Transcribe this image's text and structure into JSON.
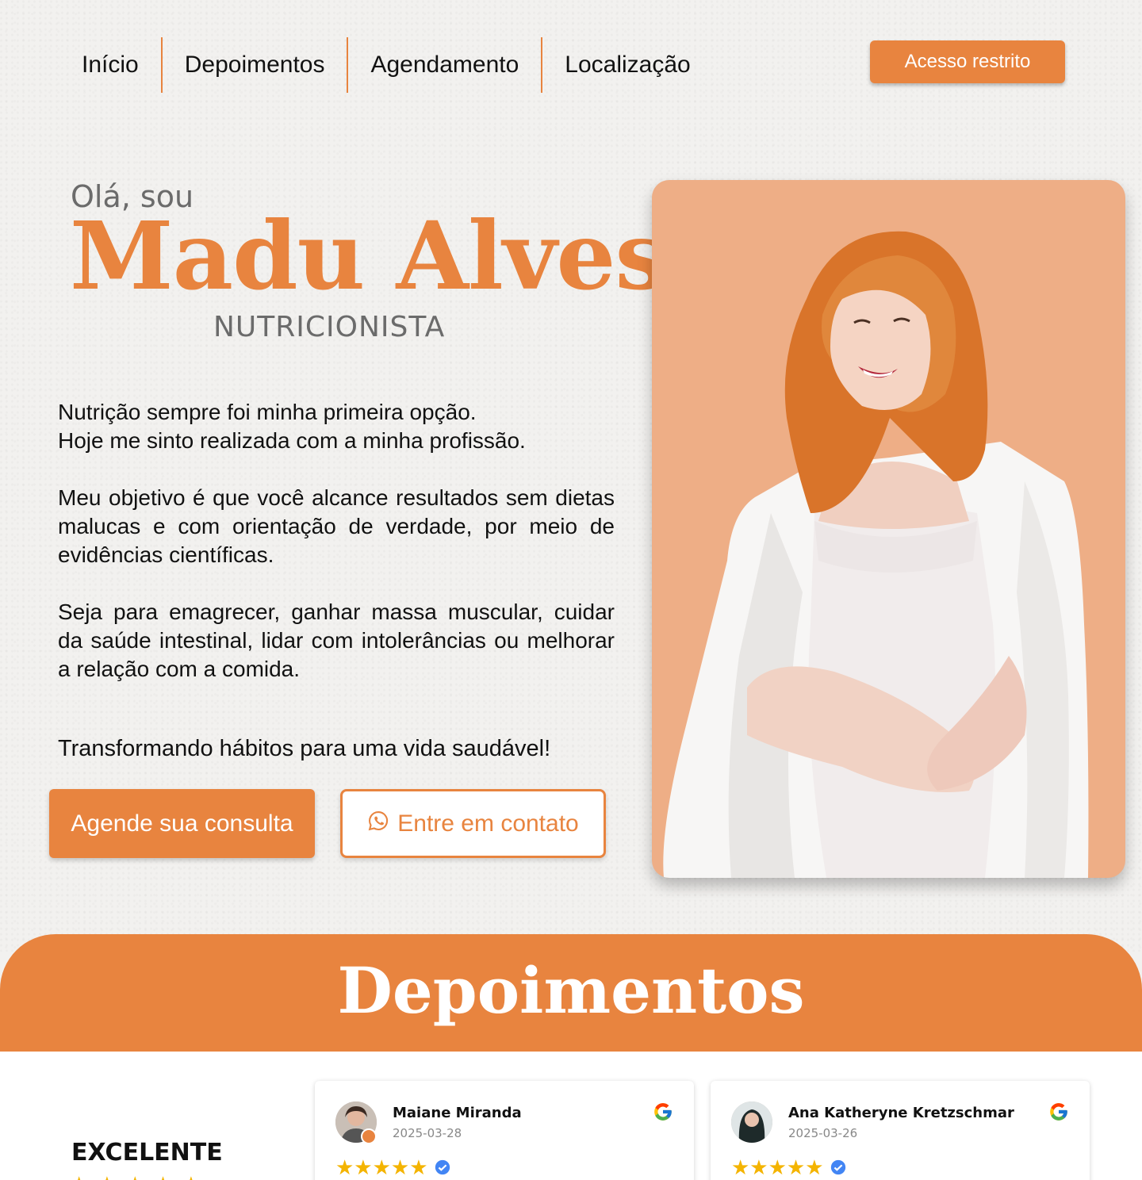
{
  "nav": {
    "items": [
      {
        "label": "Início"
      },
      {
        "label": "Depoimentos"
      },
      {
        "label": "Agendamento"
      },
      {
        "label": "Localização"
      }
    ],
    "restricted_label": "Acesso restrito"
  },
  "hero": {
    "greeting": "Olá, sou",
    "name": "Madu Alves",
    "role": "NUTRICIONISTA",
    "bio": [
      "Nutrição sempre foi minha primeira opção.\nHoje me sinto realizada com a minha profissão.",
      "Meu objetivo é que você alcance resultados sem dietas malucas e com orientação de verdade, por meio de evidências científicas.",
      "Seja para emagrecer, ganhar massa muscular, cuidar da saúde intestinal, lidar com intolerâncias ou melhorar a relação com a comida."
    ],
    "tagline": "Transformando hábitos para uma vida saudável!",
    "cta_primary": "Agende sua consulta",
    "cta_secondary": "Entre em contato"
  },
  "testimonials": {
    "title": "Depoimentos",
    "rating_label": "EXCELENTE",
    "reviews": [
      {
        "author": "Maiane Miranda",
        "date": "2025-03-28",
        "stars": 5
      },
      {
        "author": "Ana Katheryne Kretzschmar",
        "date": "2025-03-26",
        "stars": 5
      }
    ]
  },
  "colors": {
    "accent": "#e8843f",
    "photo_bg": "#eeae86",
    "star": "#f4b400"
  },
  "icons": {
    "whatsapp": "whatsapp-icon",
    "google": "google-icon",
    "verified": "verified-badge-icon"
  }
}
